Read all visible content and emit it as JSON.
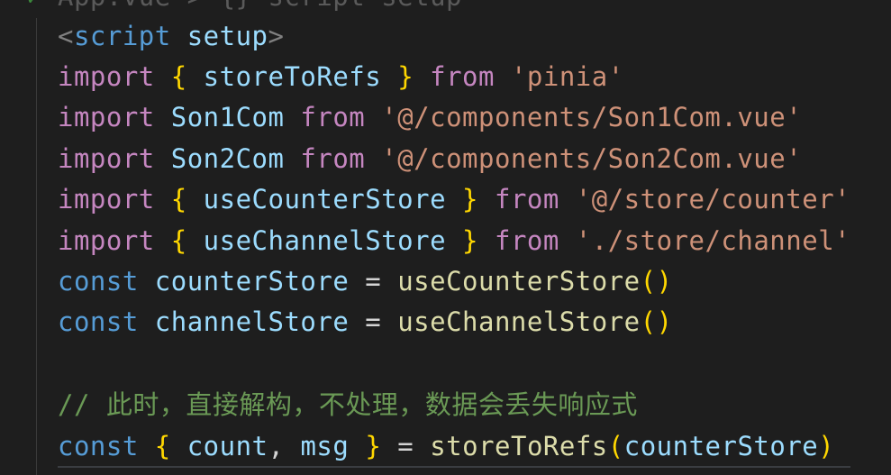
{
  "editor": {
    "partial_top": "App.vue > {} script setup",
    "lines": {
      "l1": {
        "open": "<",
        "tag": "script",
        "attr": "setup",
        "close": ">"
      },
      "l2": {
        "kw": "import",
        "ob": "{",
        "name": "storeToRefs",
        "cb": "}",
        "from": "from",
        "src": "'pinia'"
      },
      "l3": {
        "kw": "import",
        "name": "Son1Com",
        "from": "from",
        "src": "'@/components/Son1Com.vue'"
      },
      "l4": {
        "kw": "import",
        "name": "Son2Com",
        "from": "from",
        "src": "'@/components/Son2Com.vue'"
      },
      "l5": {
        "kw": "import",
        "ob": "{",
        "name": "useCounterStore",
        "cb": "}",
        "from": "from",
        "src": "'@/store/counter'"
      },
      "l6": {
        "kw": "import",
        "ob": "{",
        "name": "useChannelStore",
        "cb": "}",
        "from": "from",
        "src": "'./store/channel'"
      },
      "l7": {
        "kw": "const",
        "name": "counterStore",
        "eq": "=",
        "fn": "useCounterStore",
        "paren": "()"
      },
      "l8": {
        "kw": "const",
        "name": "channelStore",
        "eq": "=",
        "fn": "useChannelStore",
        "paren": "()"
      },
      "l10": {
        "comment": "// 此时，直接解构，不处理，数据会丢失响应式"
      },
      "l11": {
        "kw": "const",
        "ob": "{",
        "v1": "count",
        "comma": ",",
        "v2": "msg",
        "cb": "}",
        "eq": "=",
        "fn": "storeToRefs",
        "op": "(",
        "arg": "counterStore",
        "cp": ")"
      }
    }
  }
}
